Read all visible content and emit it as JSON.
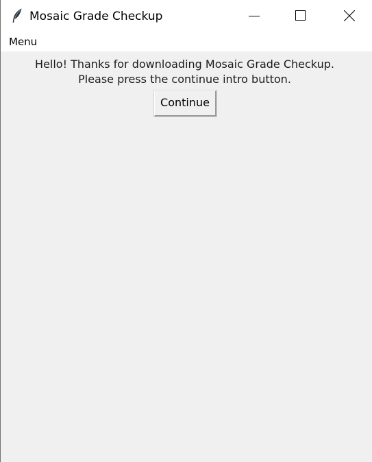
{
  "window": {
    "title": "Mosaic Grade Checkup",
    "icon": "feather-icon"
  },
  "menubar": {
    "items": [
      {
        "label": "Menu"
      }
    ]
  },
  "content": {
    "intro_line1": "Hello! Thanks for downloading Mosaic Grade Checkup.",
    "intro_line2": "Please press the continue intro button.",
    "continue_label": "Continue"
  },
  "colors": {
    "background": "#f0f0f0",
    "titlebar": "#ffffff"
  }
}
